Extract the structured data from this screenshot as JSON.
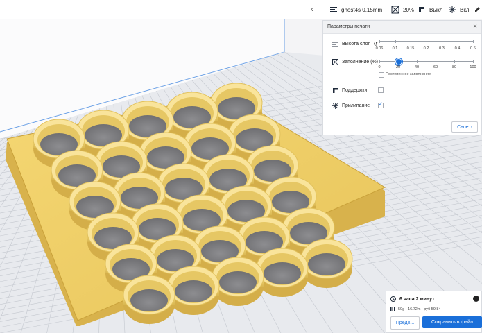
{
  "toolbar": {
    "profile_label": "ghost4s 0.15mm",
    "infill_value": "20%",
    "support_value": "Выкл",
    "adhesion_value": "Вкл"
  },
  "panel": {
    "title": "Параметры печати",
    "close_symbol": "×",
    "layer_height": {
      "label": "Высота слоя",
      "ticks": [
        "0.06",
        "0.1",
        "0.15",
        "0.2",
        "0.3",
        "0.4",
        "0.6"
      ],
      "selected": "0.15"
    },
    "infill": {
      "label": "Заполнение (%)",
      "ticks": [
        "0",
        "20",
        "40",
        "60",
        "80",
        "100"
      ],
      "value": 20
    },
    "gradual_infill_label": "Постепенное заполнение",
    "gradual_infill_checked": false,
    "supports": {
      "label": "Поддержки",
      "checked": false
    },
    "adhesion": {
      "label": "Прилипание",
      "checked": true
    },
    "custom_button_label": "Свое"
  },
  "estimate": {
    "time": "6 часа 2 минут",
    "material": "50g · 16.72m · руб 59.84",
    "info_symbol": "i",
    "preview_button": "Предв...",
    "save_button": "Сохранить в файл"
  },
  "colors": {
    "accent": "#1a6fd9",
    "model": "#f2d16b",
    "model_shadow": "#c9a13a",
    "build_plate": "#e6e8ec"
  }
}
